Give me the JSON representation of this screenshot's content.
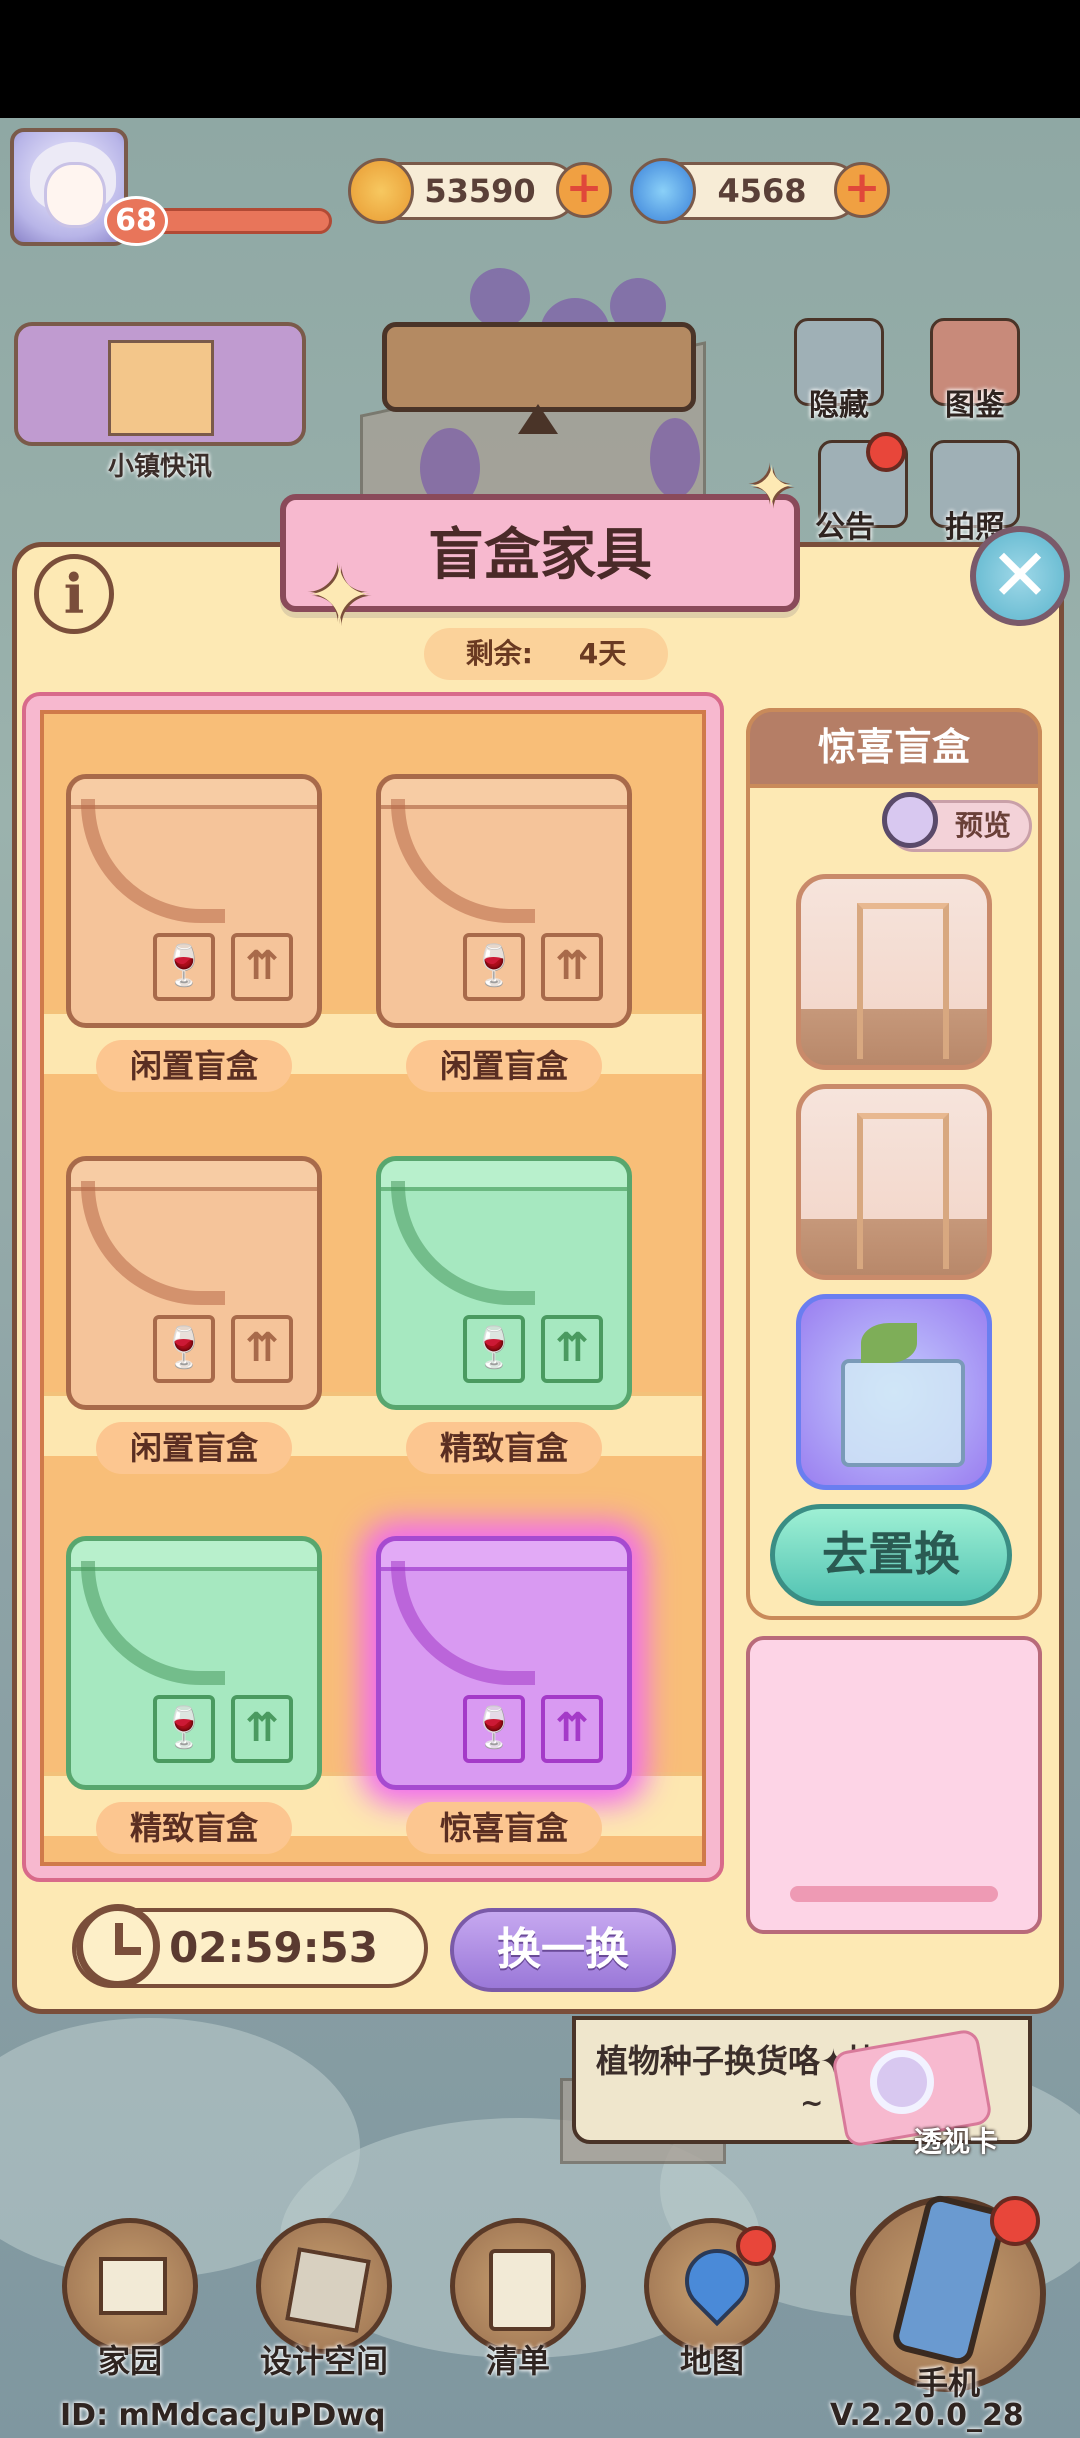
{
  "top_bar": {
    "level": "68",
    "currencies": [
      {
        "name": "coin",
        "amount": "53590",
        "icon": "leaf-coin-icon",
        "color": "#f0a042"
      },
      {
        "name": "gem",
        "amount": "4568",
        "icon": "swirl-gem-icon",
        "color": "#4a9ae8"
      }
    ],
    "plus_symbol": "+"
  },
  "side_menu": {
    "news_label": "小镇快讯",
    "hide_label": "隐藏",
    "catalog_label": "图鉴",
    "notice_label": "公告",
    "photo_label": "拍照"
  },
  "panel": {
    "title": "盲盒家具",
    "info_symbol": "i",
    "close_symbol": "✕",
    "remaining_label": "剩余:",
    "remaining_value": "4天",
    "boxes": [
      {
        "label": "闲置盲盒",
        "tier": "brown"
      },
      {
        "label": "闲置盲盒",
        "tier": "brown"
      },
      {
        "label": "闲置盲盒",
        "tier": "brown"
      },
      {
        "label": "精致盲盒",
        "tier": "green"
      },
      {
        "label": "精致盲盒",
        "tier": "green"
      },
      {
        "label": "惊喜盲盒",
        "tier": "purple"
      }
    ],
    "box_symbols": {
      "fragile": "🍷",
      "up": "⇈"
    },
    "reward": {
      "title": "惊喜盲盒",
      "preview_label": "预览",
      "exchange_label": "去置换"
    },
    "timer": "02:59:53",
    "refresh_label": "换一换"
  },
  "colors": {
    "accent_pink": "#f7b9cf",
    "panel_bg": "#fde9b4",
    "brown_box": "#f5c49a",
    "green_box": "#a6e8c0",
    "purple_box": "#d99af2"
  },
  "tip": {
    "text": "植物种子换货咯✦快来看看",
    "more": "~"
  },
  "xray_card_label": "透视卡",
  "bottom_nav": {
    "items": [
      {
        "label": "家园",
        "icon": "home-icon"
      },
      {
        "label": "设计空间",
        "icon": "design-icon"
      },
      {
        "label": "清单",
        "icon": "list-icon"
      },
      {
        "label": "地图",
        "icon": "map-pin-icon"
      }
    ],
    "phone_label": "手机"
  },
  "footer": {
    "uid": "ID: mMdcacJuPDwq",
    "version": "V.2.20.0_28"
  }
}
